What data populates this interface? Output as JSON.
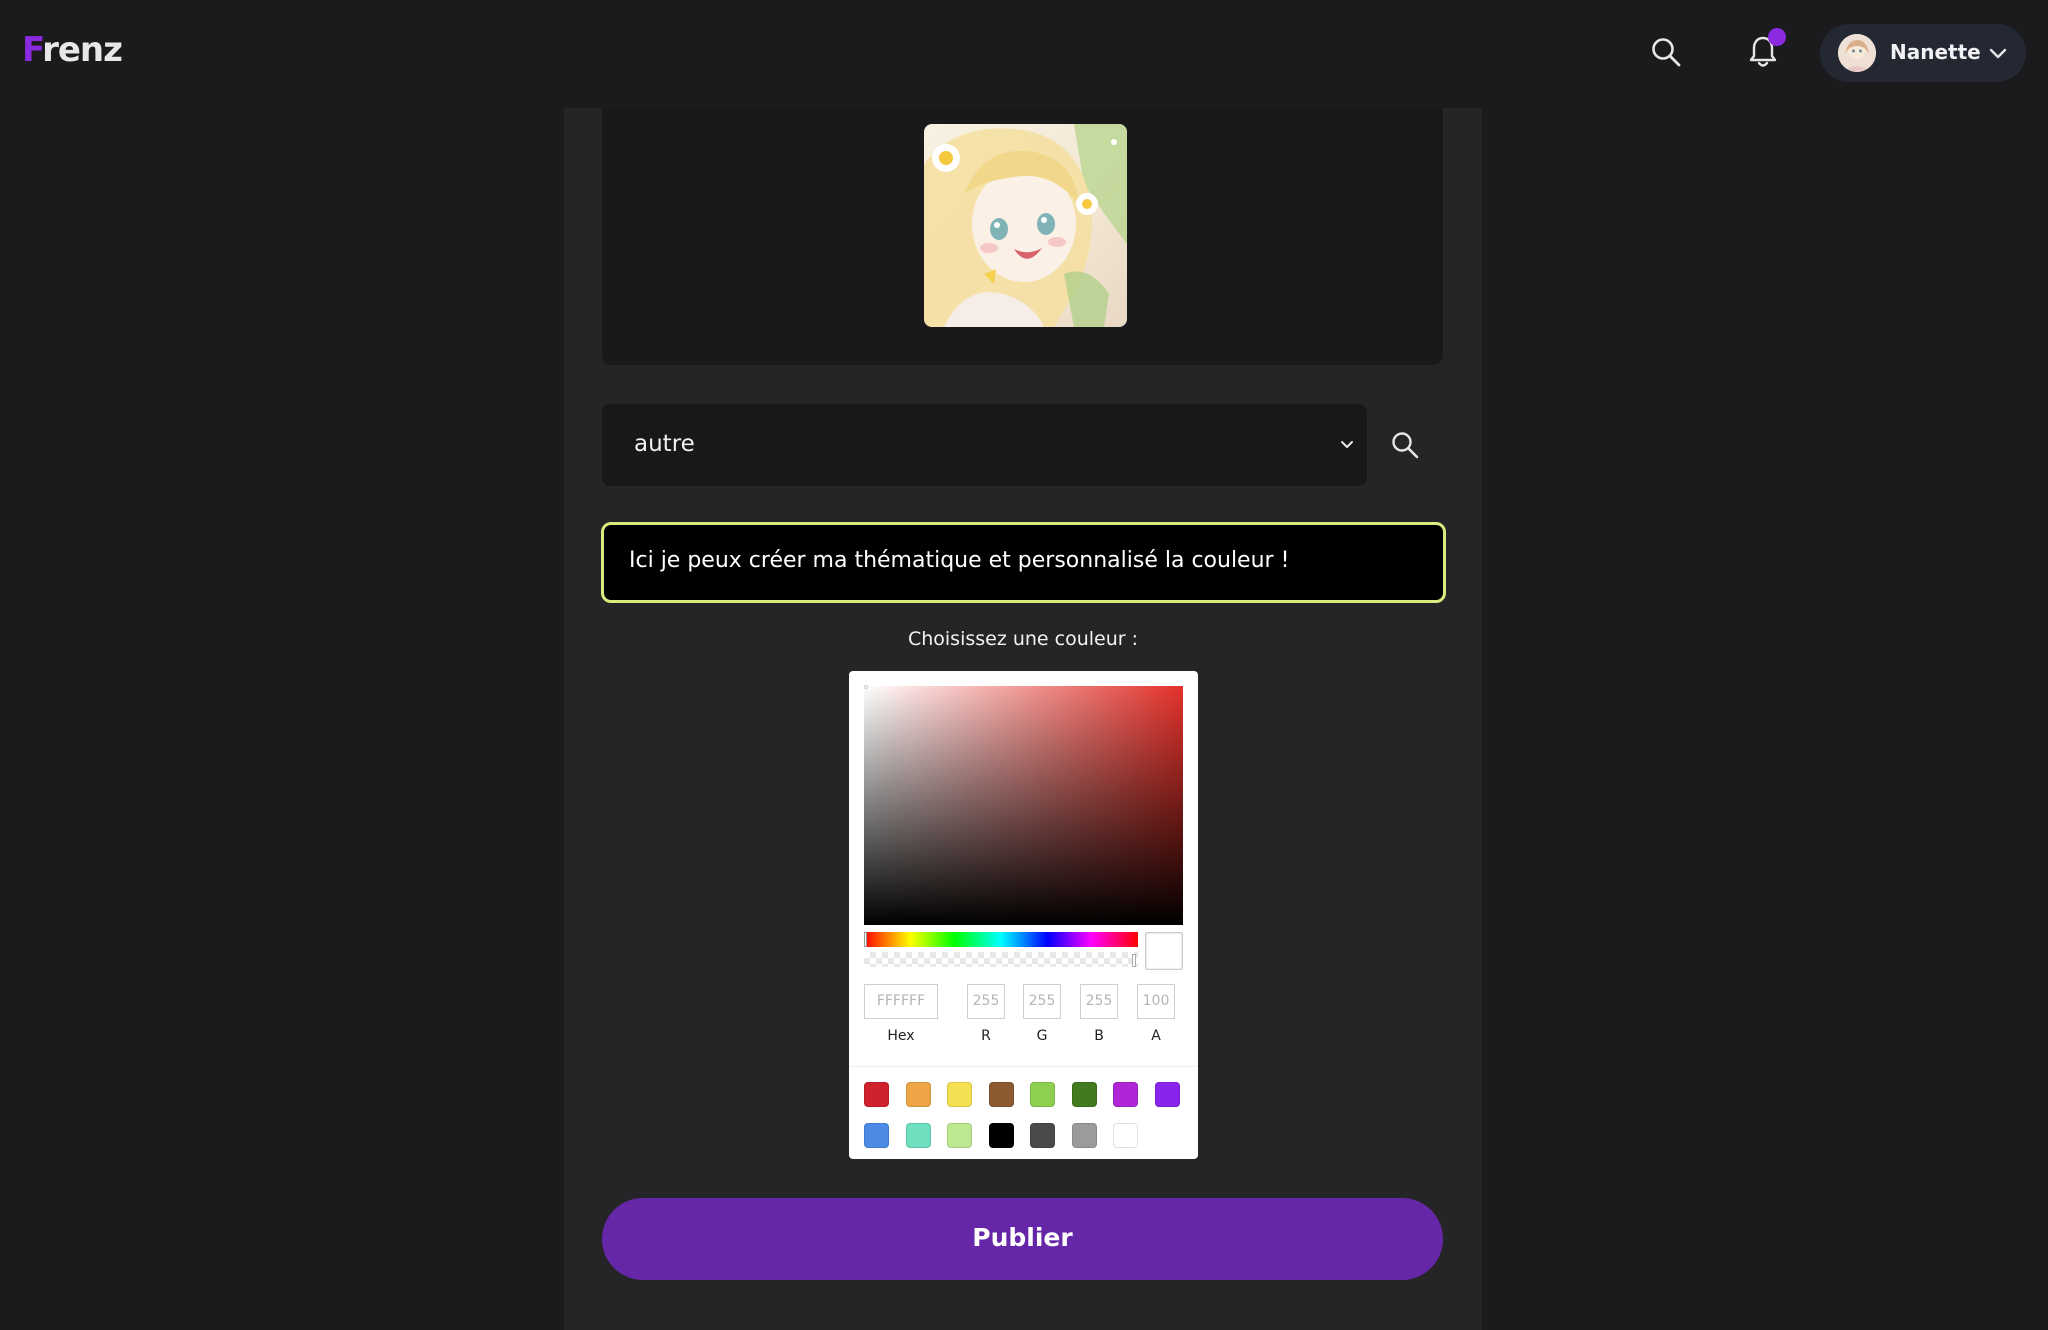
{
  "header": {
    "logo_first": "F",
    "logo_rest": "renz",
    "user_name": "Nanette"
  },
  "icons": {
    "search": "search-icon",
    "notifications": "bell-icon",
    "user_menu": "chevron-down-icon"
  },
  "post": {
    "theme_select_value": "autre",
    "custom_theme_text": "Ici je peux créer ma thématique et personnalisé la couleur !",
    "choose_color_label": "Choisissez une couleur :",
    "publish_label": "Publier"
  },
  "color_picker": {
    "hue_color": "#e4322b",
    "hex_placeholder": "FFFFFF",
    "r_placeholder": "255",
    "g_placeholder": "255",
    "b_placeholder": "255",
    "a_placeholder": "100",
    "labels": {
      "hex": "Hex",
      "r": "R",
      "g": "G",
      "b": "B",
      "a": "A"
    },
    "presets": [
      "#d0222c",
      "#eda546",
      "#f5e052",
      "#8b5a30",
      "#8dd04f",
      "#427a1f",
      "#b026d6",
      "#8924ec",
      "#4b8be6",
      "#6ee0c0",
      "#bde88f",
      "#000000",
      "#4a4a4a",
      "#9b9b9b",
      "#ffffff"
    ]
  },
  "colors": {
    "accent": "#8a2be2",
    "publish_bg": "#6527a8",
    "input_border": "#d6ec7f",
    "card_bg": "#252527",
    "page_bg": "#1b1b1d"
  }
}
